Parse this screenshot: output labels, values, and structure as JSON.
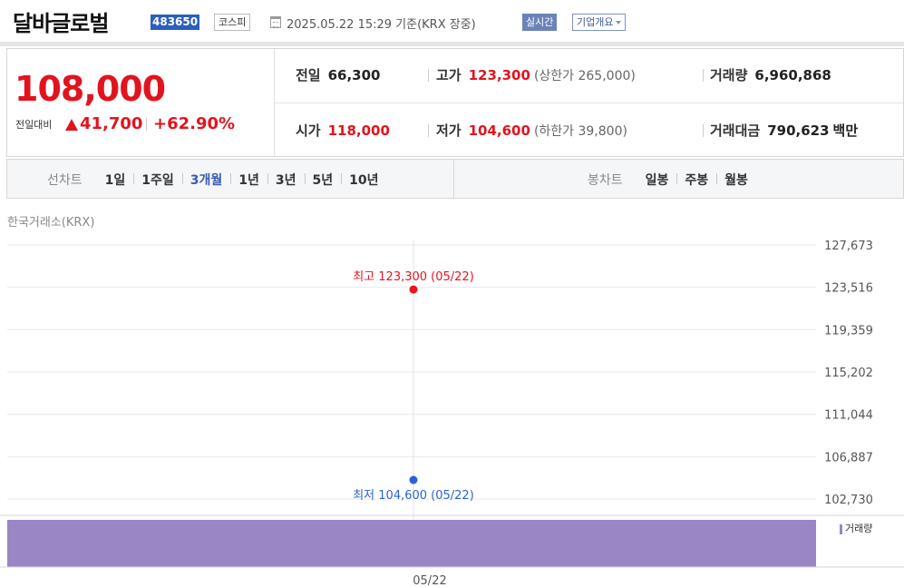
{
  "header": {
    "company": "달바글로벌",
    "code": "483650",
    "market": "코스피",
    "datetime": "2025.05.22 15:29  기준(KRX 장중)",
    "realtime_label": "실시간",
    "corp_info_label": "기업개요"
  },
  "price": {
    "current": "108,000",
    "change_label": "전일대비",
    "change_value": "41,700",
    "change_rate": "+62.90%",
    "direction": "up",
    "up_color": "#e1141e"
  },
  "stats": {
    "prev_close": {
      "label": "전일",
      "value": "66,300"
    },
    "high": {
      "label": "고가",
      "value": "123,300",
      "extra": "(상한가 265,000)"
    },
    "volume": {
      "label": "거래량",
      "value": "6,960,868"
    },
    "open": {
      "label": "시가",
      "value": "118,000"
    },
    "low": {
      "label": "저가",
      "value": "104,600",
      "extra": "(하한가 39,800)"
    },
    "trade_value": {
      "label": "거래대금",
      "value": "790,623",
      "unit": "백만"
    }
  },
  "tabs": {
    "line_chart_label": "선차트",
    "periods": [
      "1일",
      "1주일",
      "3개월",
      "1년",
      "3년",
      "5년",
      "10년"
    ],
    "active_period": "3개월",
    "candle_chart_label": "봉차트",
    "candles": [
      "일봉",
      "주봉",
      "월봉"
    ]
  },
  "chart_data": {
    "type": "line",
    "source": "한국거래소(KRX)",
    "x": [
      "05/22"
    ],
    "y_ticks": [
      "127,673",
      "123,516",
      "119,359",
      "115,202",
      "111,044",
      "106,887",
      "102,730"
    ],
    "ylim": [
      102730,
      127673
    ],
    "high": {
      "label": "최고",
      "value": 123300,
      "text": "123,300",
      "date": "(05/22)",
      "color": "#e8141e"
    },
    "low": {
      "label": "최저",
      "value": 104600,
      "text": "104,600",
      "date": "(05/22)",
      "color": "#2a62d4"
    },
    "volume_label": "거래량",
    "volume_color": "#9986c4",
    "grid": true
  }
}
